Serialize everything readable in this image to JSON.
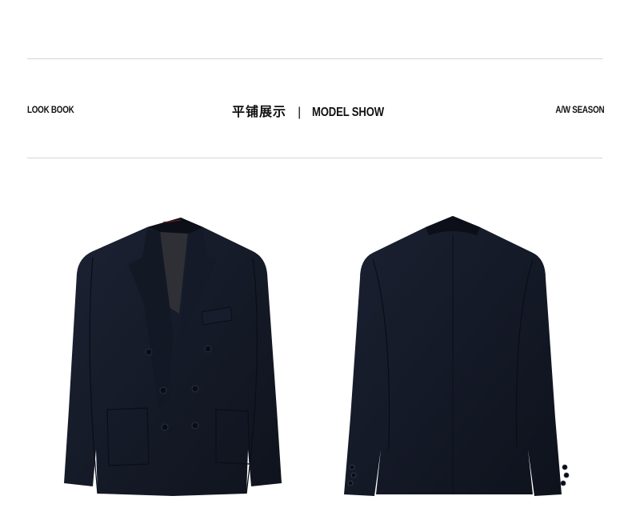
{
  "header": {
    "left_label": "LOOK BOOK",
    "title_cn": "平铺展示",
    "separator": "|",
    "title_en": "MODEL SHOW",
    "right_label": "A/W SEASON"
  },
  "colors": {
    "rule": "#d4d4d4",
    "jacket": "#161b28",
    "lining": "#3a3a3c",
    "accent_thread": "#6b1f1f"
  },
  "images": [
    {
      "name": "jacket-front-photo",
      "depicts": "jacket-front"
    },
    {
      "name": "jacket-back-photo",
      "depicts": "jacket-back"
    }
  ]
}
